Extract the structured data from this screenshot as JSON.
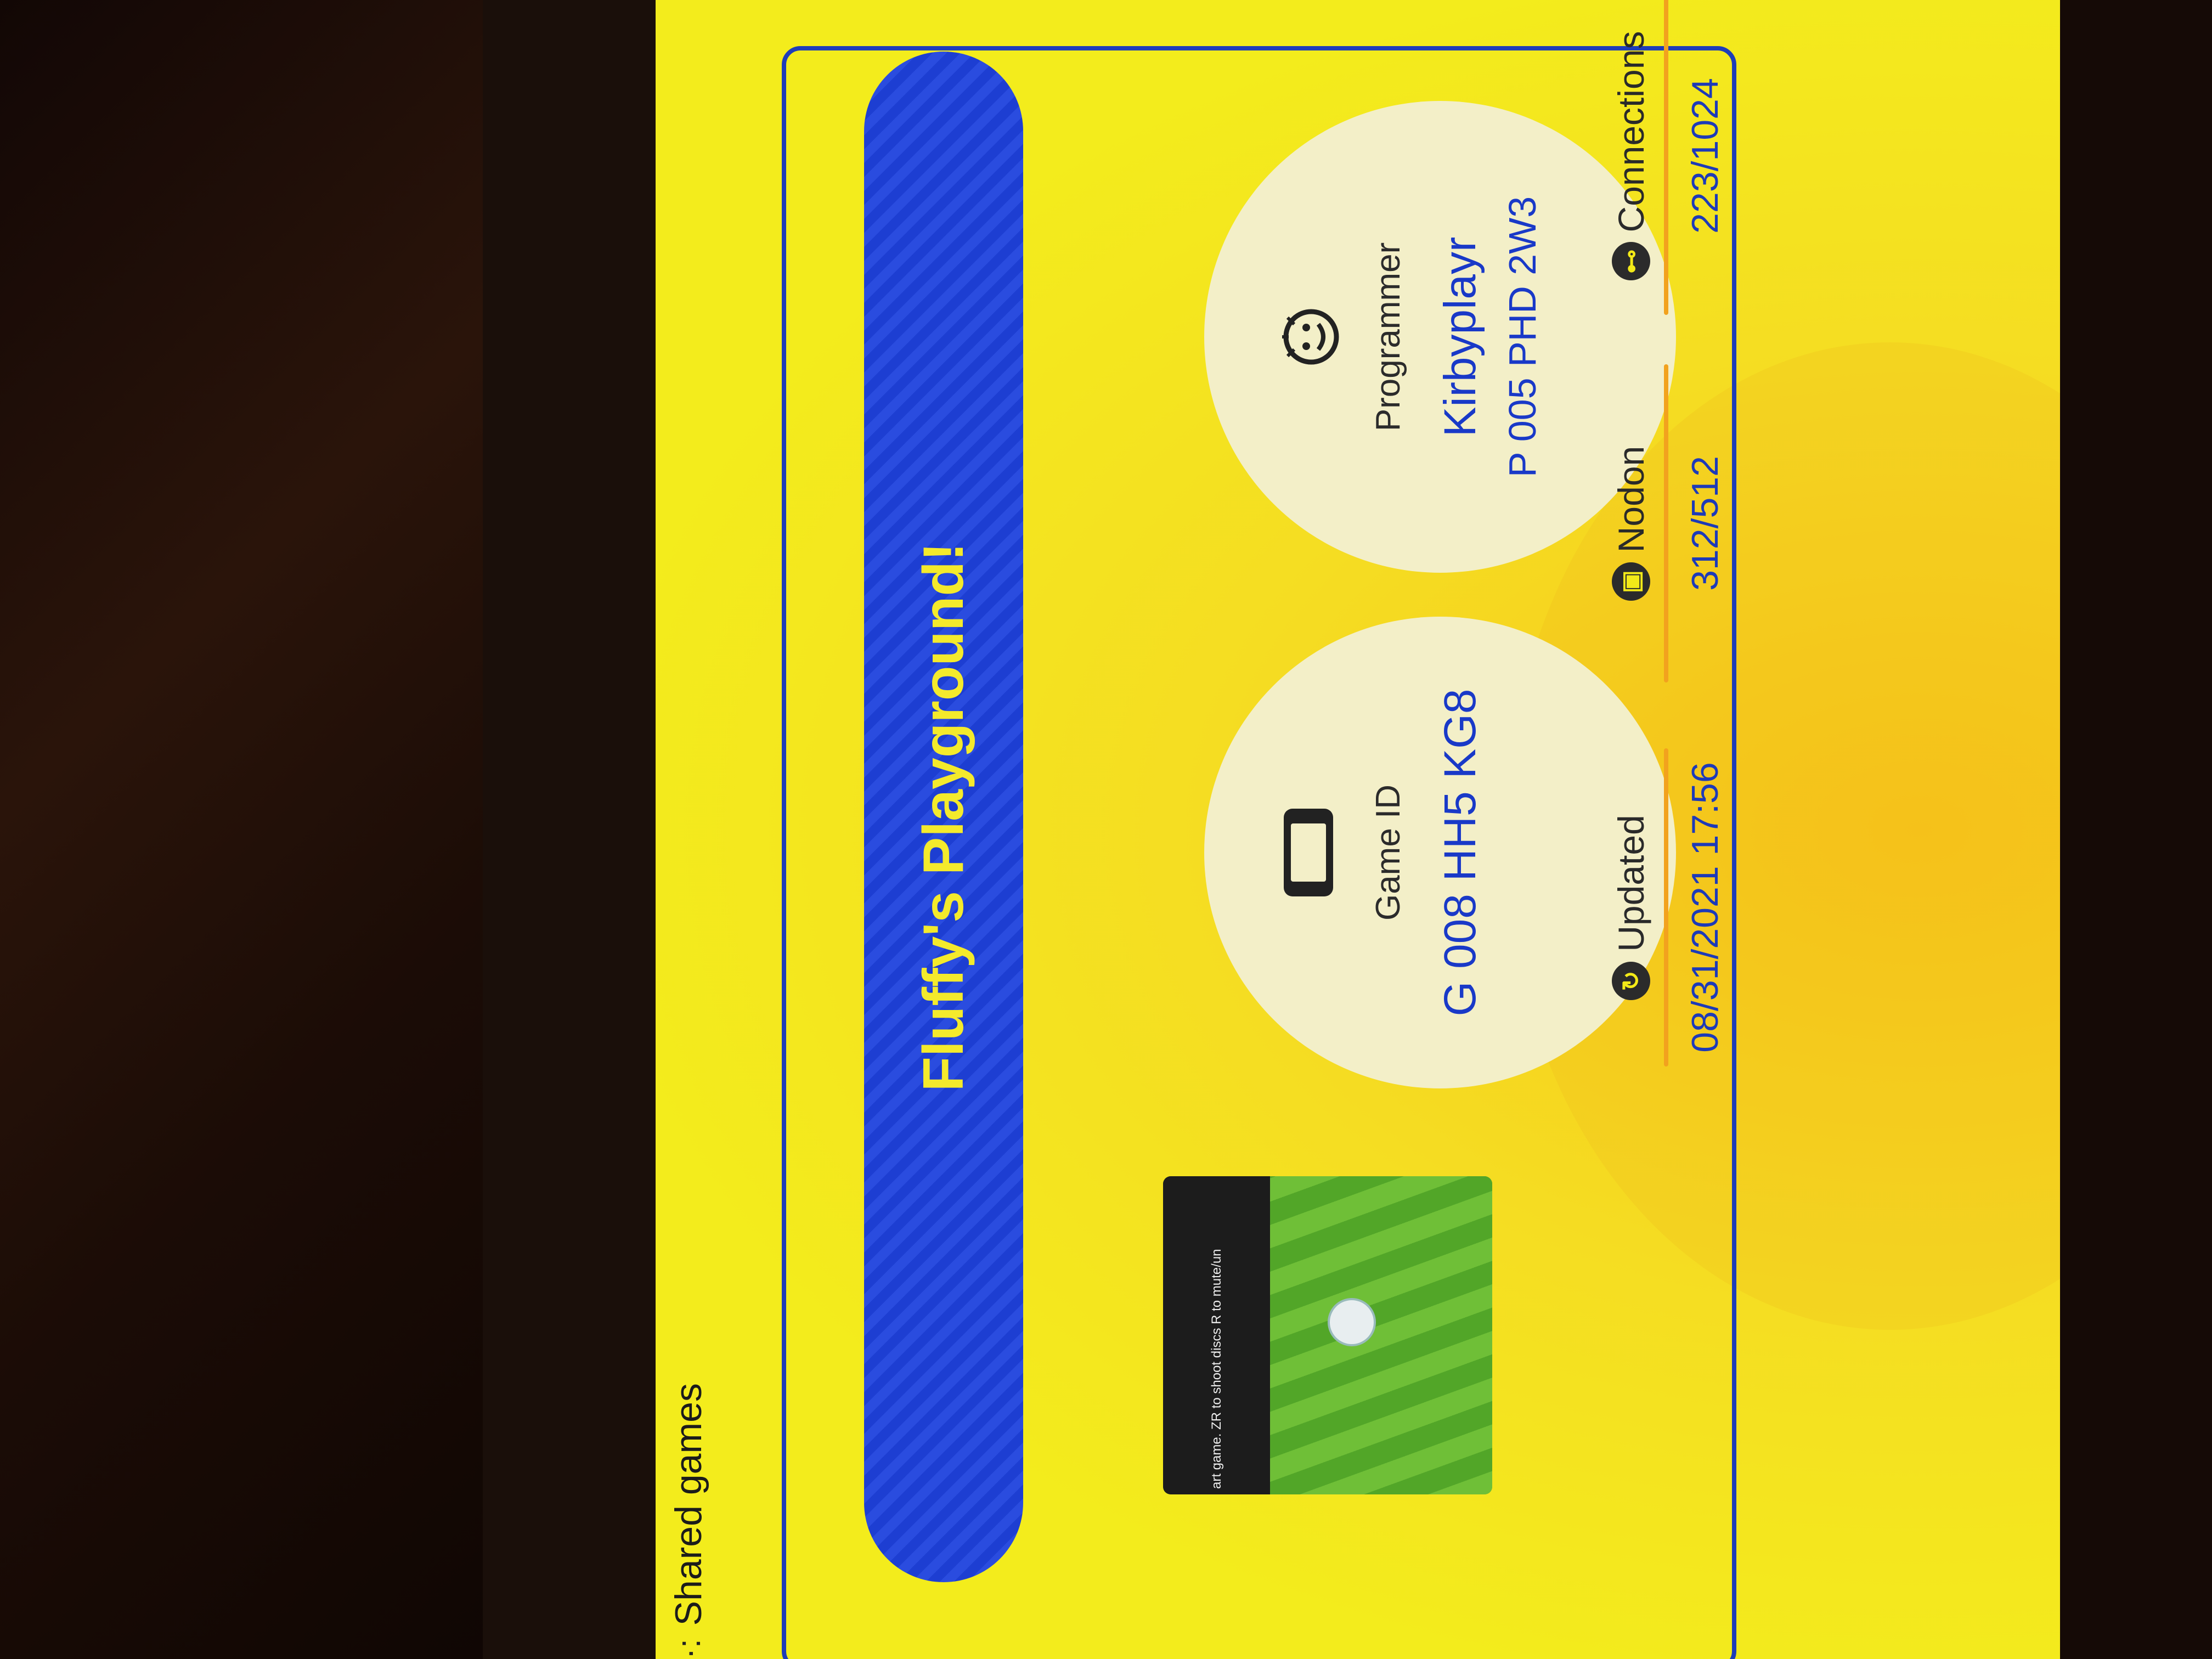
{
  "header": {
    "icon": "shared-games-icon",
    "title": "Shared games"
  },
  "game": {
    "title": "Fluffy's Playground!",
    "thumbnail_caption": "art game.  ZR to shoot discs  R to mute/un",
    "game_id_label": "Game ID",
    "game_id": "G 008 HH5 KG8",
    "programmer_label": "Programmer",
    "programmer_name": "Kirbyplayr",
    "programmer_id": "P 005 PHD 2W3"
  },
  "stats": {
    "updated_label": "Updated",
    "updated_value": "08/31/2021 17:56",
    "nodon_label": "Nodon",
    "nodon_value": "312/512",
    "connections_label": "Connections",
    "connections_value": "223/1024"
  },
  "colors": {
    "background": "#f3ea18",
    "banner": "#1d3ed2",
    "title_text": "#f4ea2c",
    "value_text": "#1939c8",
    "accent_line": "#f2a21e"
  }
}
